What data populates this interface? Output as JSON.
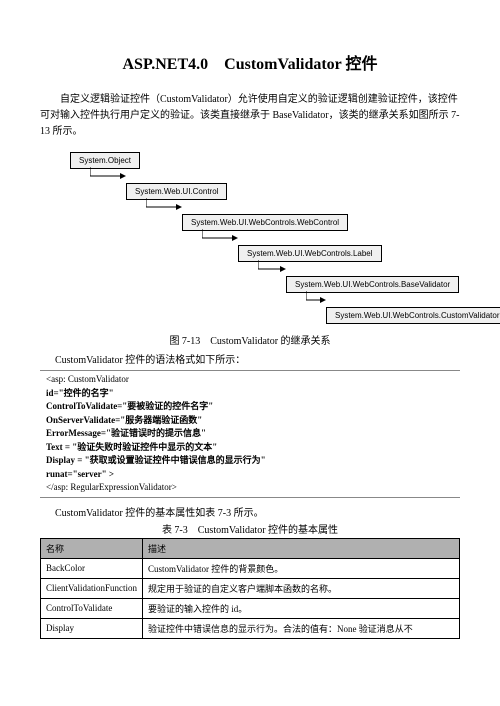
{
  "title": "ASP.NET4.0　CustomValidator 控件",
  "intro": "自定义逻辑验证控件（CustomValidator）允许使用自定义的验证逻辑创建验证控件，该控件可对输入控件执行用户定义的验证。该类直接继承于 BaseValidator，该类的继承关系如图所示 7-13 所示。",
  "hierarchy": {
    "n0": "System.Object",
    "n1": "System.Web.UI.Control",
    "n2": "System.Web.UI.WebControls.WebControl",
    "n3": "System.Web.UI.WebControls.Label",
    "n4": "System.Web.UI.WebControls.BaseValidator",
    "n5": "System.Web.UI.WebControls.CustomValidator"
  },
  "figCaption": "图 7-13　CustomValidator 的继承关系",
  "syntaxIntro": "CustomValidator 控件的语法格式如下所示：",
  "code": {
    "l0": "<asp: CustomValidator",
    "l1": "id=\"控件的名字\"",
    "l2": "ControlToValidate=\"要被验证的控件名字\"",
    "l3": "OnServerValidate=\"服务器端验证函数\"",
    "l4": "ErrorMessage=\"验证错误时的提示信息\"",
    "l5": "Text = \"验证失败时验证控件中显示的文本\"",
    "l6": "Display = \"获取或设置验证控件中错误信息的显示行为\"",
    "l7": "runat=\"server\" >",
    "l8": "</asp: RegularExpressionValidator>"
  },
  "tableIntro": "CustomValidator 控件的基本属性如表 7-3 所示。",
  "tableCaption": "表 7-3　CustomValidator 控件的基本属性",
  "table": {
    "h0": "名称",
    "h1": "描述",
    "r0c0": "BackColor",
    "r0c1": "CustomValidator 控件的背景颜色。",
    "r1c0": "ClientValidationFunction",
    "r1c1": "规定用于验证的自定义客户端脚本函数的名称。",
    "r2c0": "ControlToValidate",
    "r2c1": "要验证的输入控件的 id。",
    "r3c0": "Display",
    "r3c1": "验证控件中错误信息的显示行为。合法的值有：None 验证消息从不"
  }
}
